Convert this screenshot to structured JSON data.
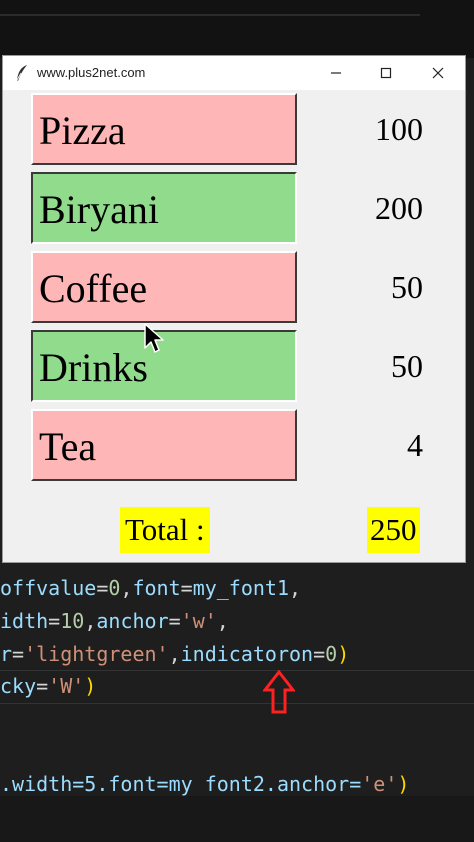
{
  "window": {
    "title": "www.plus2net.com"
  },
  "items": [
    {
      "label": "Pizza",
      "price": "100",
      "state": "off",
      "color": "#ffb6b6"
    },
    {
      "label": "Biryani",
      "price": "200",
      "state": "on",
      "color": "#90dc8c"
    },
    {
      "label": "Coffee",
      "price": "50",
      "state": "off",
      "color": "#ffb6b6"
    },
    {
      "label": "Drinks",
      "price": "50",
      "state": "on",
      "color": "#90dc8c"
    },
    {
      "label": "Tea",
      "price": "4",
      "state": "off",
      "color": "#ffb6b6"
    }
  ],
  "total": {
    "label": "Total :",
    "value": "250",
    "highlight": "#ffff00"
  },
  "code": {
    "line1": {
      "a": "offvalue",
      "b": "=",
      "c": "0",
      "d": ",",
      "e": "font",
      "f": "=",
      "g": "my_font1",
      "h": ","
    },
    "line2": {
      "a": "idth",
      "b": "=",
      "c": "10",
      "d": ",",
      "e": "anchor",
      "f": "=",
      "g": "'w'",
      "h": ","
    },
    "line3": {
      "a": "r",
      "b": "=",
      "c": "'lightgreen'",
      "d": ",",
      "e": "indicatoron",
      "f": "=",
      "g": "0",
      "h": ")"
    },
    "line4": {
      "a": "cky",
      "b": "=",
      "c": "'W'",
      "d": ")"
    },
    "line5": {
      "a": ".width=5.font=my font2.anchor=",
      "b": "'e'",
      "c": ")"
    }
  },
  "icons": {
    "app": "feather-icon",
    "arrow": "up-arrow-icon",
    "cursor": "mouse-pointer-icon"
  }
}
